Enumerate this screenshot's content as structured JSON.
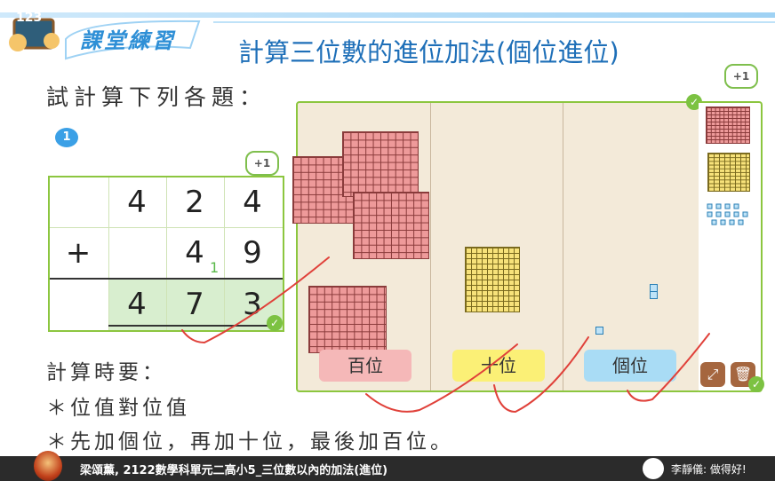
{
  "header": {
    "logo_text": "課堂練習",
    "logo_digits": "123",
    "title": "計算三位數的進位加法(個位進位)"
  },
  "prompt": "試計算下列各題：",
  "question_number": "1",
  "plus_one": "+1",
  "problem": {
    "row1": [
      "",
      "4",
      "2",
      "4"
    ],
    "row2": [
      "+",
      "",
      "4",
      "9"
    ],
    "carry": "1",
    "answer": [
      "",
      "4",
      "7",
      "3"
    ]
  },
  "board": {
    "labels": {
      "hundreds": "百位",
      "tens": "十位",
      "ones": "個位"
    },
    "colors": {
      "hundreds_label": "#f5b8b8",
      "tens_label": "#fbf076",
      "ones_label": "#a9dcf5",
      "border": "#8cc63f"
    }
  },
  "rules": {
    "heading": "計算時要：",
    "line1": "＊位值對位值",
    "line2": "＊先加個位，再加十位，最後加百位。"
  },
  "status_bar": {
    "left": "梁頌薰, 2122數學科單元二高小5_三位數以內的加法(進位)",
    "right": "李靜儀: 做得好!"
  },
  "icons": {
    "expand": "expand-icon",
    "trash": "trash-icon",
    "check": "check-icon"
  }
}
